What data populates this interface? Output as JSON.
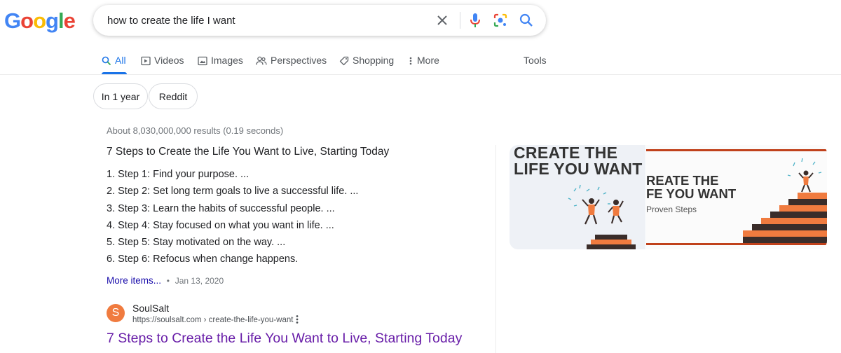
{
  "logo": {
    "letters": [
      "G",
      "o",
      "o",
      "g",
      "l",
      "e"
    ],
    "colors": [
      "#4285f4",
      "#ea4335",
      "#fbbc05",
      "#4285f4",
      "#34a853",
      "#ea4335"
    ]
  },
  "search": {
    "query": "how to create the life I want",
    "icons": [
      "close-icon",
      "mic-icon",
      "lens-icon",
      "search-icon"
    ]
  },
  "tabs": [
    {
      "label": "All",
      "icon": "search-icon",
      "active": true
    },
    {
      "label": "Videos",
      "icon": "play-icon"
    },
    {
      "label": "Images",
      "icon": "image-icon"
    },
    {
      "label": "Perspectives",
      "icon": "people-icon"
    },
    {
      "label": "Shopping",
      "icon": "tag-icon"
    },
    {
      "label": "More",
      "icon": "more-vert-icon"
    }
  ],
  "tools_label": "Tools",
  "chips": [
    "In 1 year",
    "Reddit"
  ],
  "stats": "About 8,030,000,000 results (0.19 seconds)",
  "featured_snippet": {
    "title": "7 Steps to Create the Life You Want to Live, Starting Today",
    "steps": [
      "1. Step 1: Find your purpose. ...",
      "2. Step 2: Set long term goals to live a successful life. ...",
      "3. Step 3: Learn the habits of successful people. ...",
      "4. Step 4: Stay focused on what you want in life. ...",
      "5. Step 5: Stay motivated on the way. ...",
      "6. Step 6: Refocus when change happens."
    ],
    "more_items": "More items...",
    "separator": "•",
    "date": "Jan 13, 2020"
  },
  "source": {
    "favicon_letter": "S",
    "name": "SoulSalt",
    "url": "https://soulsalt.com › create-the-life-you-want",
    "link_title": "7 Steps to Create the Life You Want to Live, Starting Today"
  },
  "images": [
    {
      "headline_line1": "CREATE THE",
      "headline_line2": "LIFE YOU WANT"
    },
    {
      "headline_line1": "REATE THE",
      "headline_line2": "FE YOU WANT",
      "subline": "Proven Steps"
    }
  ],
  "colors": {
    "accent": "#1a73e8",
    "link": "#1a0dab",
    "visited": "#681da8",
    "brand_orange": "#f07b3f"
  }
}
